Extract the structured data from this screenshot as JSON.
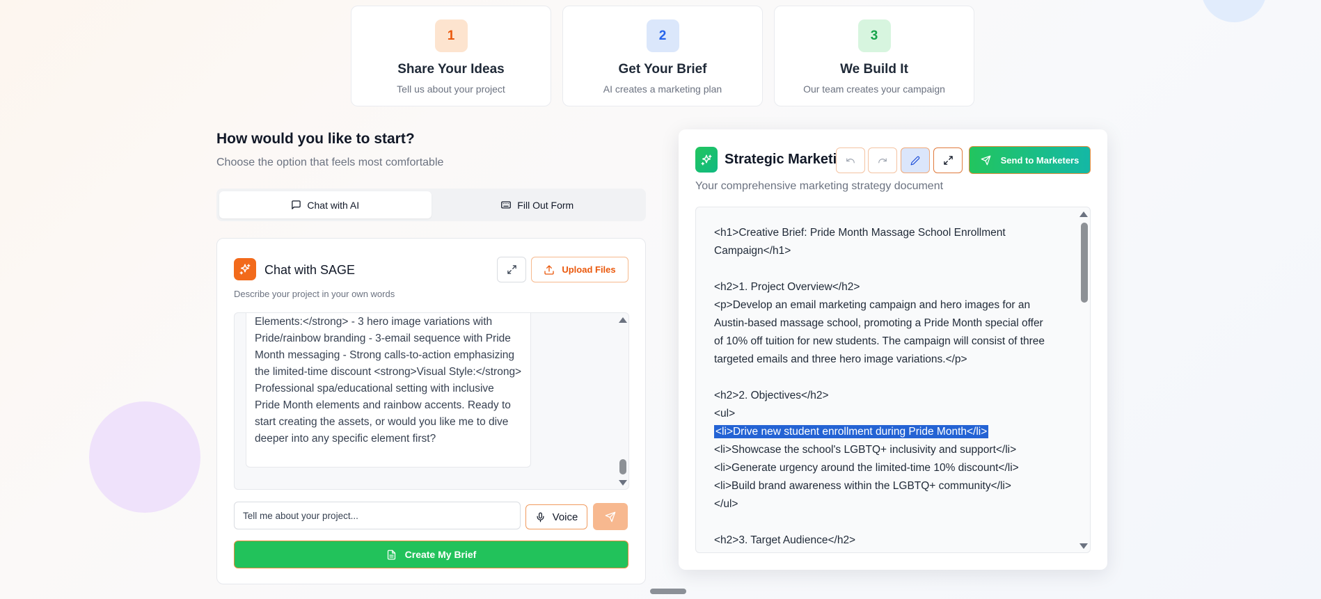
{
  "steps": [
    {
      "num": "1",
      "title": "Share Your Ideas",
      "sub": "Tell us about your project",
      "bg": "#fde4cf",
      "fg": "#ea580c"
    },
    {
      "num": "2",
      "title": "Get Your Brief",
      "sub": "AI creates a marketing plan",
      "bg": "#dbe7fb",
      "fg": "#2563eb"
    },
    {
      "num": "3",
      "title": "We Build It",
      "sub": "Our team creates your campaign",
      "bg": "#d7f5df",
      "fg": "#16a34a"
    }
  ],
  "start": {
    "title": "How would you like to start?",
    "subtitle": "Choose the option that feels most comfortable"
  },
  "tabs": {
    "chat": "Chat with AI",
    "form": "Fill Out Form"
  },
  "chat": {
    "title": "Chat with SAGE",
    "subtitle": "Describe your project in your own words",
    "upload_label": "Upload Files",
    "message": "Elements:</strong> - 3 hero image variations with Pride/rainbow branding - 3-email sequence with Pride Month messaging - Strong calls-to-action emphasizing the limited-time discount <strong>Visual Style:</strong> Professional spa/educational setting with inclusive Pride Month elements and rainbow accents. Ready to start creating the assets, or would you like me to dive deeper into any specific element first?",
    "input_placeholder": "Tell me about your project...",
    "voice_label": "Voice",
    "create_label": "Create My Brief"
  },
  "doc": {
    "title": "Strategic Marketing Brief",
    "subtitle": "Your comprehensive marketing strategy document",
    "send_label": "Send to Marketers",
    "lines": [
      "<h1>Creative Brief: Pride Month Massage School Enrollment",
      "Campaign</h1>",
      "",
      "<h2>1. Project Overview</h2>",
      "<p>Develop an email marketing campaign and hero images for an",
      "Austin-based massage school, promoting a Pride Month special offer",
      "of 10% off tuition for new students. The campaign will consist of three",
      "targeted emails and three hero image variations.</p>",
      "",
      "<h2>2. Objectives</h2>",
      "<ul>",
      "<li>Drive new student enrollment during Pride Month</li>",
      "<li>Showcase the school's LGBTQ+ inclusivity and support</li>",
      "<li>Generate urgency around the limited-time 10% discount</li>",
      "<li>Build brand awareness within the LGBTQ+ community</li>",
      "</ul>",
      "",
      "<h2>3. Target Audience</h2>"
    ]
  },
  "colors": {
    "accent_orange": "#f26a1b",
    "accent_green": "#22c25b",
    "highlight_blue": "#2463d4"
  },
  "icons": [
    "sparkles-icon",
    "expand-icon",
    "upload-icon",
    "mic-icon",
    "send-icon",
    "file-text-icon",
    "undo-icon",
    "redo-icon",
    "pencil-icon",
    "message-square-icon",
    "keyboard-icon"
  ]
}
